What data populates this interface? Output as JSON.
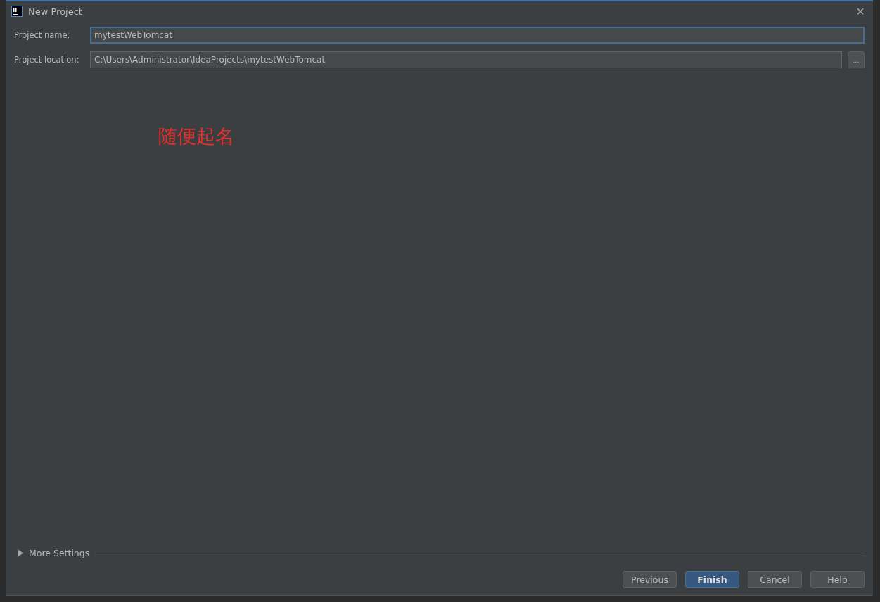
{
  "window": {
    "title": "New Project",
    "close": "×"
  },
  "fields": [
    {
      "label": "Project name:",
      "value": "mytestWebTomcat",
      "focused": true
    },
    {
      "label": "Project location:",
      "value": "C:\\Users\\Administrator\\IdeaProjects\\mytestWebTomcat",
      "focused": false,
      "browse": "..."
    }
  ],
  "annotation": "随便起名",
  "more_settings": {
    "label": "More Settings",
    "expanded": false
  },
  "buttons": [
    {
      "label": "Previous",
      "default": false
    },
    {
      "label": "Finish",
      "default": true
    },
    {
      "label": "Cancel",
      "default": false
    },
    {
      "label": "Help",
      "default": false
    }
  ]
}
